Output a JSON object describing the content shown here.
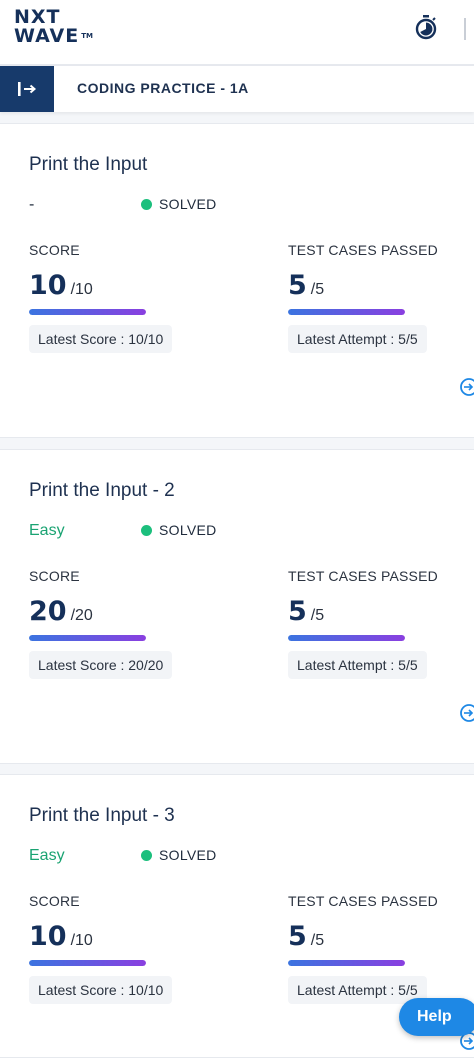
{
  "header": {
    "logo_line1": "NXT",
    "logo_line2": "WAVE",
    "logo_tm": "TM",
    "timer_icon": "timer-icon"
  },
  "subheader": {
    "title": "CODING PRACTICE - 1A",
    "collapse_icon": "collapse-sidebar-icon"
  },
  "labels": {
    "score": "SCORE",
    "test_cases": "TEST CASES PASSED"
  },
  "colors": {
    "brand": "#173a6b",
    "solved_dot": "#1cbf7d",
    "easy": "#1aa372",
    "bar_start": "#3b74e0",
    "bar_end": "#8a3fe0",
    "help": "#1e88e5"
  },
  "cards": [
    {
      "title": "Print the Input",
      "difficulty": "-",
      "status": "SOLVED",
      "score": "10",
      "score_total": "/10",
      "score_fraction": 1.0,
      "tests": "5",
      "tests_total": "/5",
      "tests_fraction": 1.0,
      "latest_score": "Latest Score : 10/10",
      "latest_attempt": "Latest Attempt : 5/5"
    },
    {
      "title": "Print the Input - 2",
      "difficulty": "Easy",
      "status": "SOLVED",
      "score": "20",
      "score_total": "/20",
      "score_fraction": 1.0,
      "tests": "5",
      "tests_total": "/5",
      "tests_fraction": 1.0,
      "latest_score": "Latest Score : 20/20",
      "latest_attempt": "Latest Attempt : 5/5"
    },
    {
      "title": "Print the Input - 3",
      "difficulty": "Easy",
      "status": "SOLVED",
      "score": "10",
      "score_total": "/10",
      "score_fraction": 1.0,
      "tests": "5",
      "tests_total": "/5",
      "tests_fraction": 1.0,
      "latest_score": "Latest Score : 10/10",
      "latest_attempt": "Latest Attempt : 5/5"
    }
  ],
  "help_label": "Help"
}
